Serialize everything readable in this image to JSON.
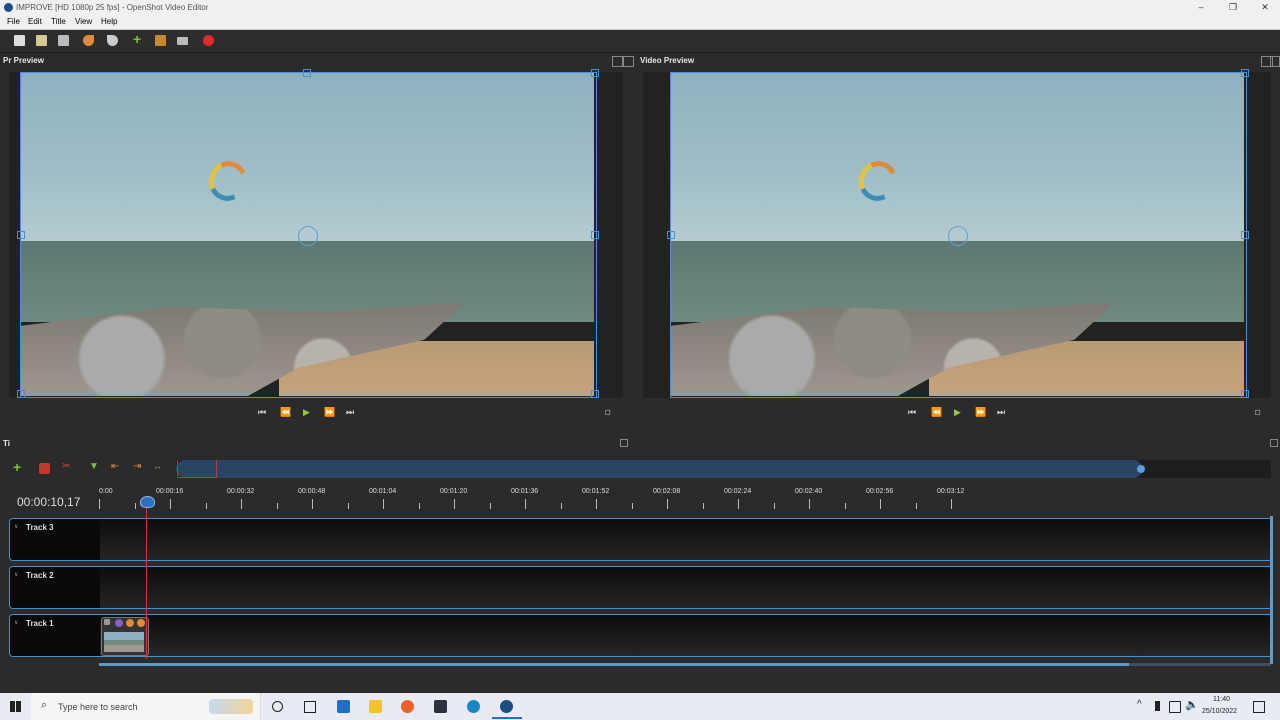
{
  "window": {
    "title": "IMPROVE [HD 1080p 25 fps] - OpenShot Video Editor",
    "controls": [
      "–",
      "❐",
      "✕"
    ]
  },
  "menu": {
    "items": [
      "File",
      "Edit",
      "Title",
      "View",
      "Help"
    ]
  },
  "toolbar": {
    "icons": [
      "new-project-icon",
      "open-project-icon",
      "save-project-icon",
      "undo-icon",
      "redo-icon",
      "import-files-icon",
      "profile-icon",
      "fullscreen-icon",
      "export-video-icon"
    ]
  },
  "panels": {
    "left_title": "Pr Preview",
    "right_title": "Video Preview"
  },
  "timeline": {
    "panel_title": "Ti",
    "current_time": "00:00:10,17",
    "ruler_labels": [
      "0:00",
      "00:00:16",
      "00:00:32",
      "00:00:48",
      "00:01:04",
      "00:01:20",
      "00:01:36",
      "00:01:52",
      "00:02:08",
      "00:02:24",
      "00:02:40",
      "00:02:56",
      "00:03:12"
    ],
    "tracks": [
      {
        "name": "Track 3"
      },
      {
        "name": "Track 2"
      },
      {
        "name": "Track 1"
      }
    ]
  },
  "taskbar": {
    "search_placeholder": "Type here to search",
    "time": "11:40",
    "date": "25/10/2022"
  },
  "colors": {
    "accent": "#4a90d9",
    "playhead": "#e03030",
    "play_button": "#9ac53c"
  }
}
